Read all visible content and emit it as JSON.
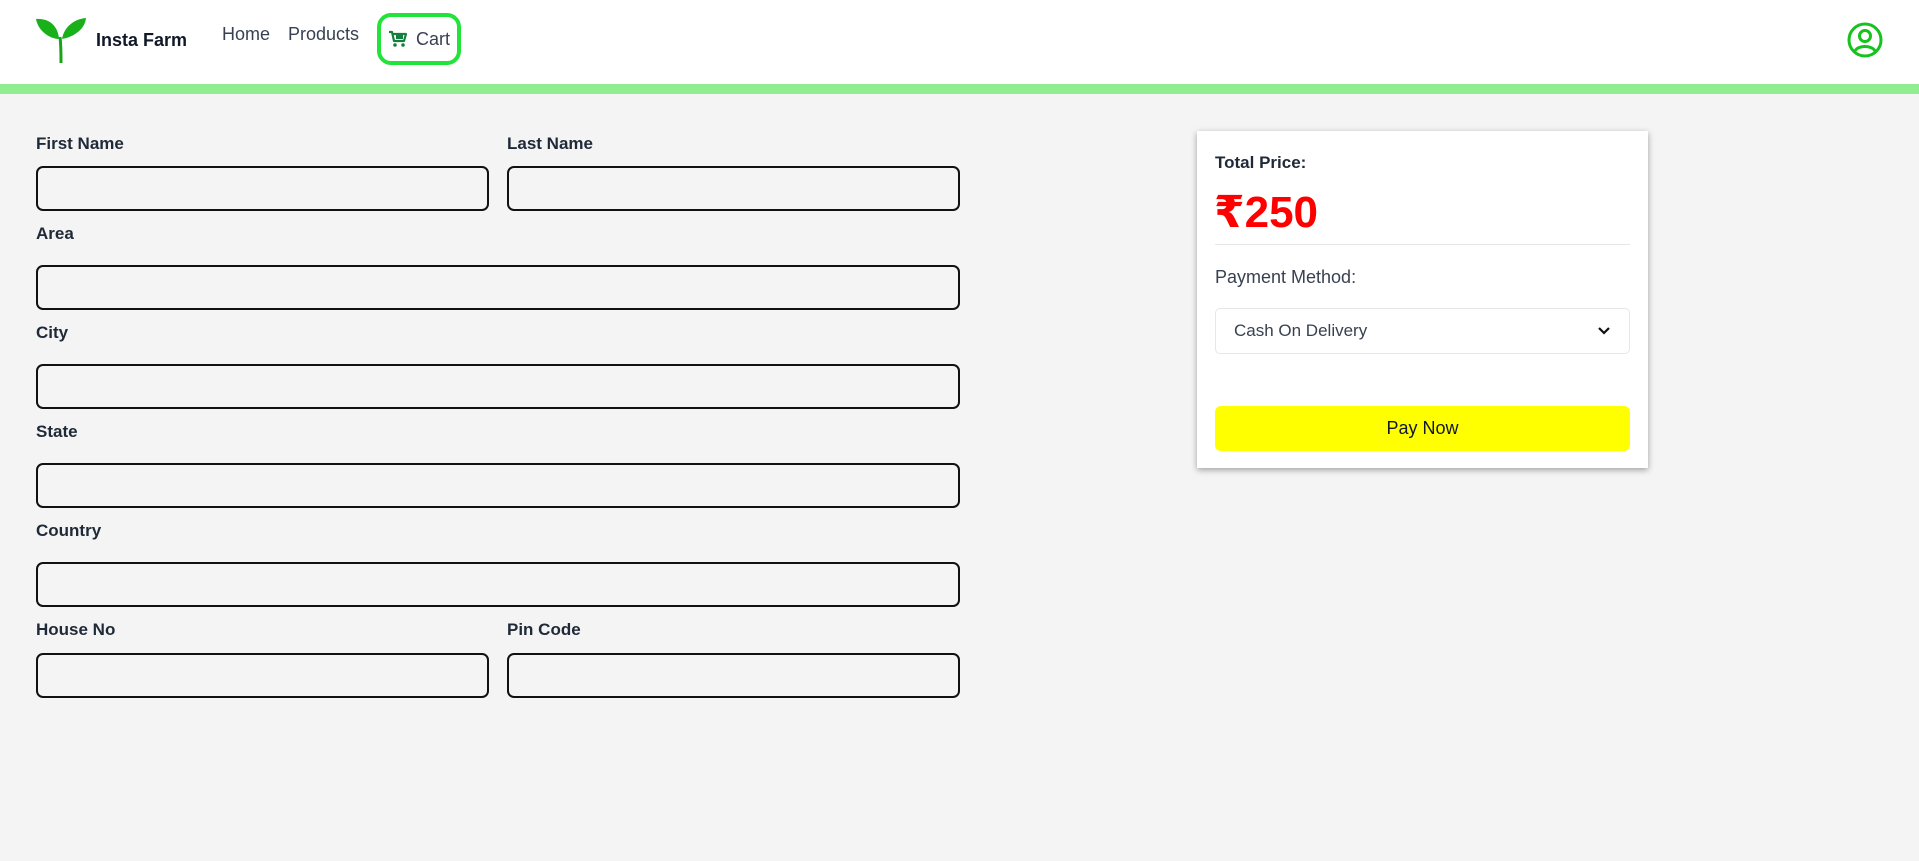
{
  "brand": {
    "name": "Insta Farm",
    "logo_icon": "leaf-sprout-icon"
  },
  "nav": {
    "home": "Home",
    "products": "Products",
    "cart": "Cart",
    "cart_icon": "shopping-cart-icon",
    "user_icon": "user-circle-icon"
  },
  "form": {
    "first_name_label": "First Name",
    "last_name_label": "Last Name",
    "area_label": "Area",
    "city_label": "City",
    "state_label": "State",
    "country_label": "Country",
    "house_no_label": "House No",
    "pin_code_label": "Pin Code",
    "first_name_value": "",
    "last_name_value": "",
    "area_value": "",
    "city_value": "",
    "state_value": "",
    "country_value": "",
    "house_no_value": "",
    "pin_code_value": ""
  },
  "summary": {
    "total_label": "Total Price:",
    "total_price": "₹250",
    "payment_label": "Payment Method:",
    "payment_selected": "Cash On Delivery",
    "pay_button": "Pay Now"
  },
  "colors": {
    "accent_green": "#22e33a",
    "strip_green": "#90ee90",
    "price_red": "#ff0000",
    "pay_button_yellow": "#ffff00"
  }
}
